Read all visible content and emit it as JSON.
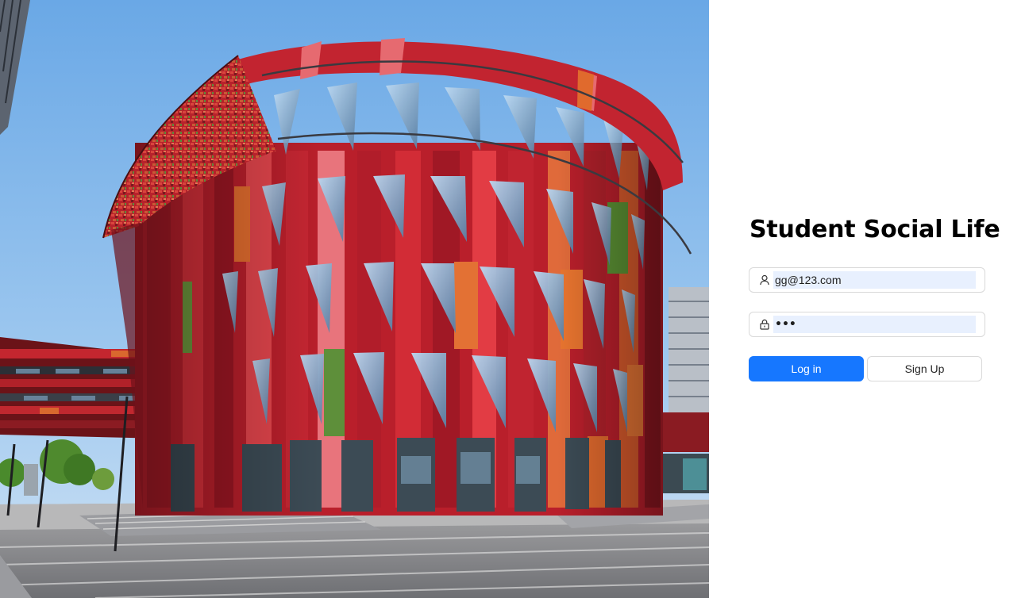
{
  "hero": {
    "image_subject": "building-photo"
  },
  "login": {
    "title": "Student Social Life",
    "email": {
      "value": "gg@123.com",
      "icon": "user-icon"
    },
    "password": {
      "value": "•••",
      "icon": "lock-icon"
    },
    "login_label": "Log in",
    "signup_label": "Sign Up"
  },
  "colors": {
    "primary": "#1677ff",
    "autofill_bg": "#e8f0fe",
    "border": "#d9d9d9"
  }
}
